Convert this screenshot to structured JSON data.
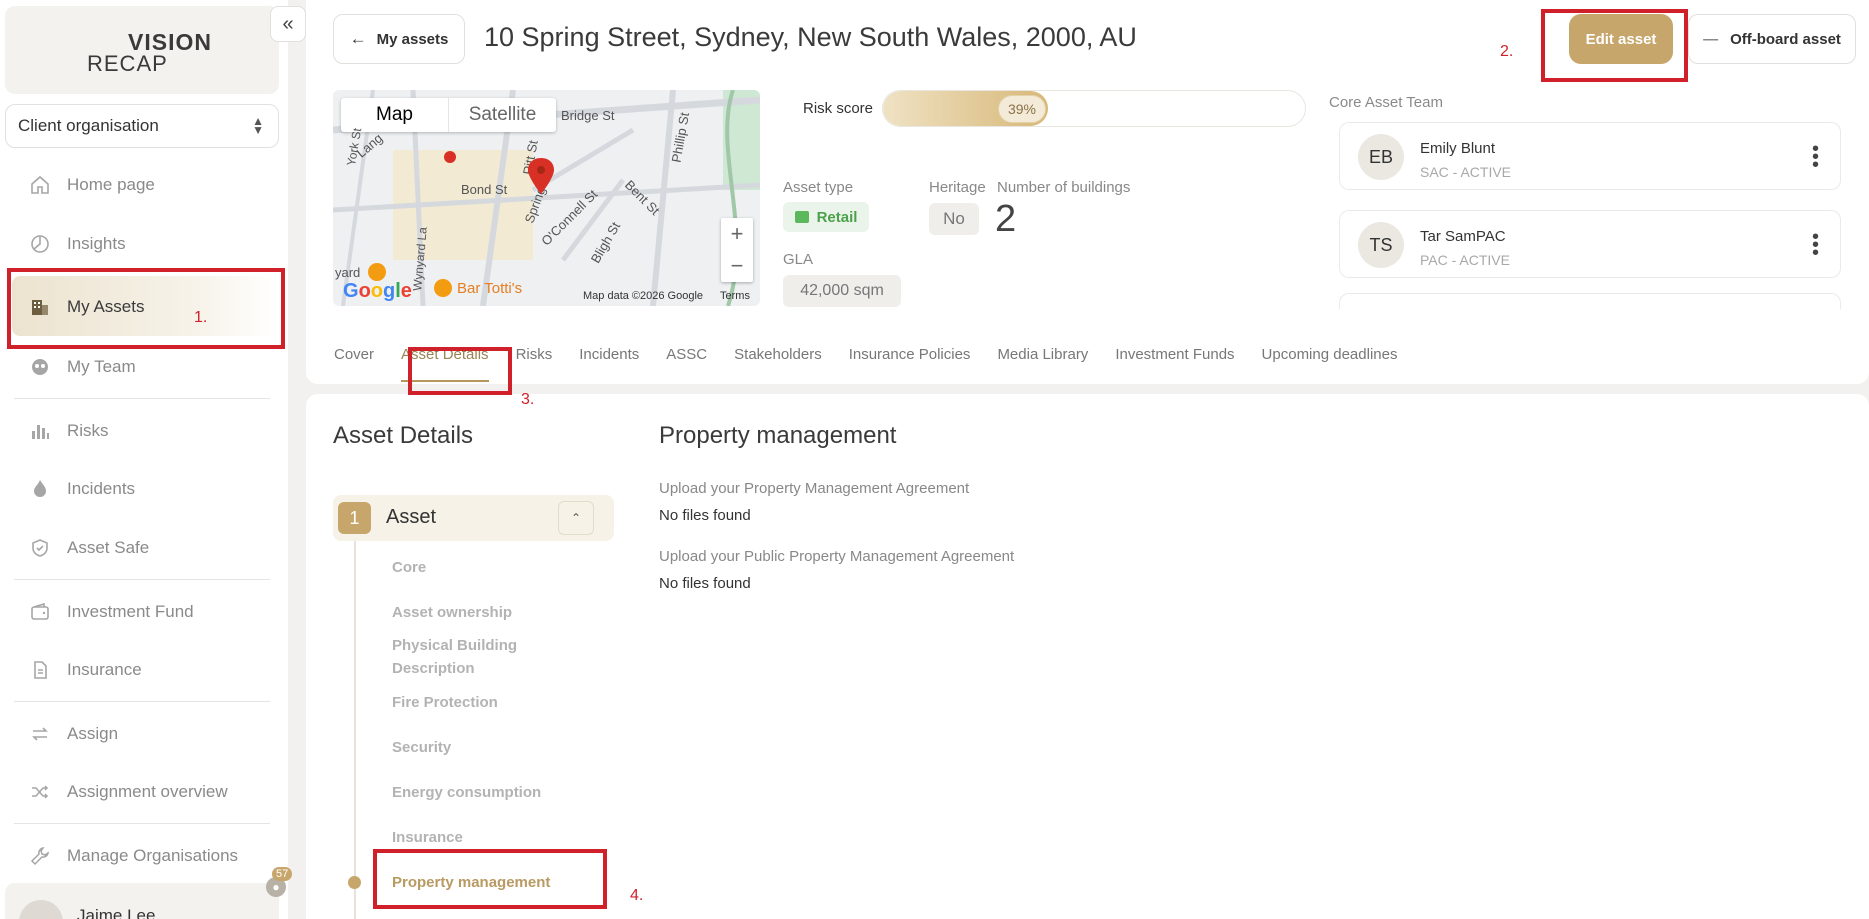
{
  "sidebar": {
    "logo_top": "VISION",
    "logo_bottom": "RECAP",
    "org_select": "Client organisation",
    "items": [
      {
        "label": "Home page"
      },
      {
        "label": "Insights"
      },
      {
        "label": "My Assets"
      },
      {
        "label": "My Team"
      },
      {
        "label": "Risks"
      },
      {
        "label": "Incidents"
      },
      {
        "label": "Asset Safe"
      },
      {
        "label": "Investment Fund"
      },
      {
        "label": "Insurance"
      },
      {
        "label": "Assign"
      },
      {
        "label": "Assignment overview"
      },
      {
        "label": "Manage Organisations"
      }
    ],
    "user_name": "Jaime Lee",
    "notification_count": "57"
  },
  "header": {
    "back_label": "My assets",
    "title": "10 Spring Street, Sydney, New South Wales, 2000, AU",
    "edit_label": "Edit asset",
    "offboard_label": "Off-board asset"
  },
  "map": {
    "map_tab": "Map",
    "satellite_tab": "Satellite",
    "attribution": "Map data ©2026 Google",
    "terms": "Terms",
    "google": "Google",
    "streets": [
      "Bridge St",
      "Bond St",
      "Pitt St",
      "Spring St",
      "O'Connell St",
      "Bent St",
      "Bligh St",
      "Phillip St",
      "Wynyard La",
      "Lang",
      "York St"
    ],
    "poi": "Bar Totti's",
    "poi_yard": "yard"
  },
  "risk": {
    "label": "Risk score",
    "value_text": "39%",
    "value": 0.39
  },
  "meta": {
    "asset_type_label": "Asset type",
    "asset_type": "Retail",
    "heritage_label": "Heritage",
    "heritage": "No",
    "buildings_label": "Number of buildings",
    "buildings": "2",
    "gla_label": "GLA",
    "gla": "42,000 sqm"
  },
  "team": {
    "title": "Core Asset Team",
    "members": [
      {
        "initials": "EB",
        "name": "Emily Blunt",
        "role": "SAC - ACTIVE"
      },
      {
        "initials": "TS",
        "name": "Tar SamPAC",
        "role": "PAC - ACTIVE"
      }
    ]
  },
  "tabs": [
    "Cover",
    "Asset Details",
    "Risks",
    "Incidents",
    "ASSC",
    "Stakeholders",
    "Insurance Policies",
    "Media Library",
    "Investment Funds",
    "Upcoming deadlines"
  ],
  "details": {
    "title": "Asset Details",
    "step_number": "1",
    "step_label": "Asset",
    "sub_items": [
      "Core",
      "Asset ownership",
      "Physical Building Description",
      "Fire Protection",
      "Security",
      "Energy consumption",
      "Insurance",
      "Property management"
    ]
  },
  "property_management": {
    "title": "Property management",
    "upload1_label": "Upload your Property Management Agreement",
    "upload1_value": "No files found",
    "upload2_label": "Upload your Public Property Management Agreement",
    "upload2_value": "No files found"
  },
  "annotations": [
    "1.",
    "2.",
    "3.",
    "4."
  ],
  "colors": {
    "accent": "#c7a66b",
    "annotation": "#d0202a",
    "retail_green": "#4ca14c"
  }
}
